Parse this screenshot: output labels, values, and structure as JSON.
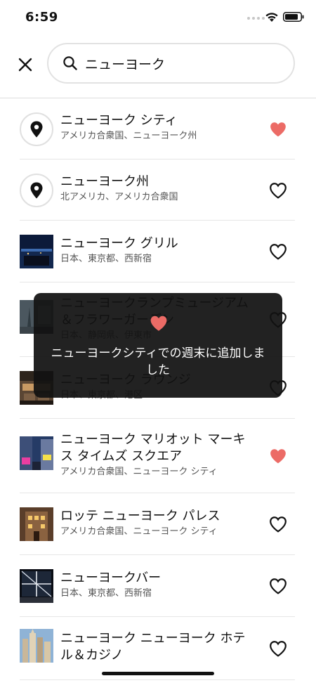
{
  "status_bar": {
    "time": "6:59"
  },
  "search": {
    "query": "ニューヨーク",
    "icons": {
      "close": "close-icon",
      "search": "search-icon"
    }
  },
  "colors": {
    "heart_filled": "#ec6b66",
    "heart_outline": "#111111",
    "toast_background": "#1a1a1a"
  },
  "results": [
    {
      "title": "ニューヨーク シティ",
      "subtitle": "アメリカ合衆国、ニューヨーク州",
      "thumb": "location-pin",
      "saved": true
    },
    {
      "title": "ニューヨーク州",
      "subtitle": "北アメリカ、アメリカ合衆国",
      "thumb": "location-pin",
      "saved": false
    },
    {
      "title": "ニューヨーク グリル",
      "subtitle": "日本、東京都、西新宿",
      "thumb": "photo-night-city",
      "saved": false
    },
    {
      "title": "ニューヨークランプミュージアム＆フラワーガーデン",
      "subtitle": "日本、静岡県、伊東市",
      "thumb": "photo-garden",
      "saved": false
    },
    {
      "title": "ニューヨーク ラウンジ",
      "subtitle": "日本、東京都、港区",
      "thumb": "photo-lounge",
      "saved": false
    },
    {
      "title": "ニューヨーク マリオット マーキス タイムズ スクエア",
      "subtitle": "アメリカ合衆国、ニューヨーク シティ",
      "thumb": "photo-times-square",
      "saved": true
    },
    {
      "title": "ロッテ ニューヨーク パレス",
      "subtitle": "アメリカ合衆国、ニューヨーク シティ",
      "thumb": "photo-palace",
      "saved": false
    },
    {
      "title": "ニューヨークバー",
      "subtitle": "日本、東京都、西新宿",
      "thumb": "photo-bar-window",
      "saved": false
    },
    {
      "title": "ニューヨーク ニューヨーク ホテル＆カジノ",
      "subtitle": "",
      "thumb": "photo-casino",
      "saved": false
    }
  ],
  "toast": {
    "icon": "heart-icon",
    "message": "ニューヨークシティでの週末に追加しました"
  }
}
